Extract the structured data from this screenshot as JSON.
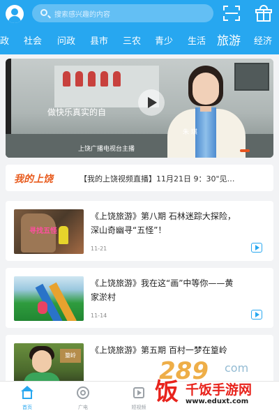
{
  "header": {
    "search_placeholder": "搜索感兴趣的内容",
    "brand_color": "#27a7f0"
  },
  "categories": [
    {
      "label": "政"
    },
    {
      "label": "社会"
    },
    {
      "label": "问政"
    },
    {
      "label": "县市"
    },
    {
      "label": "三农"
    },
    {
      "label": "青少"
    },
    {
      "label": "生活"
    },
    {
      "label": "旅游",
      "active": true
    },
    {
      "label": "经济"
    }
  ],
  "banner": {
    "caption_main": "做快乐真实的自",
    "caption_name": "朱 琪",
    "caption_role": "上饶广播电视台主播",
    "active_dot_index": 3,
    "active_dot_color": "#e8541e"
  },
  "notice": {
    "logo": "我的上饶",
    "text": "【我的上饶视频直播】11月21日 9：30\"见…"
  },
  "articles": [
    {
      "title": "《上饶旅游》第八期 石林迷踪大探险，深山奇幽寻“五怪”！",
      "date": "11-21",
      "thumb_text": "寻找五怪"
    },
    {
      "title": "《上饶旅游》我在这“画”中等你——黄家淤村",
      "date": "11-14"
    },
    {
      "title": "《上饶旅游》第五期 百村一梦在篁岭",
      "date": "",
      "thumb_text": "篁岭"
    }
  ],
  "tabbar": {
    "items": [
      {
        "label": "首页",
        "icon": "home-icon",
        "active": true
      },
      {
        "label": "广电",
        "icon": "radio-icon"
      },
      {
        "label": "短视频",
        "icon": "short-video-icon"
      }
    ]
  },
  "watermark": {
    "number": "289",
    "com": "com",
    "site": "千饭手游网",
    "url": "www.eduxt.com",
    "fan": "饭"
  }
}
